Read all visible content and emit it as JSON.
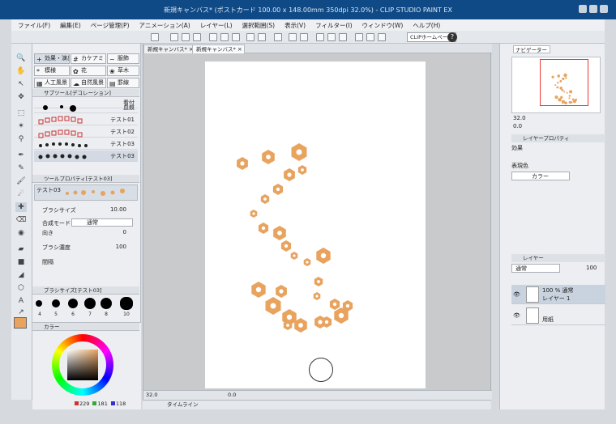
{
  "window": {
    "title": "新規キャンバス* (ポストカード 100.00 x 148.00mm 350dpi 32.0%) - CLIP STUDIO PAINT EX"
  },
  "menu": [
    "ファイル(F)",
    "編集(E)",
    "ページ管理(P)",
    "アニメーション(A)",
    "レイヤー(L)",
    "選択範囲(S)",
    "表示(V)",
    "フィルター(I)",
    "ウィンドウ(W)",
    "ヘルプ(H)"
  ],
  "command_bar": {
    "clip_home_label": "CLIPホームページ",
    "help_icon": "?"
  },
  "subtool_groups": [
    {
      "label": "効果・演出",
      "icon": "+"
    },
    {
      "label": "カケアミ・",
      "icon": "#"
    },
    {
      "label": "服飾",
      "icon": "~"
    },
    {
      "label": "模様",
      "icon": "*"
    },
    {
      "label": "花",
      "icon": "✿"
    },
    {
      "label": "草木",
      "icon": "❀"
    },
    {
      "label": "人工風景",
      "icon": "▦"
    },
    {
      "label": "自然風景",
      "icon": "☁"
    },
    {
      "label": "罫線",
      "icon": "▤"
    }
  ],
  "subtool_panel": {
    "title": "サブツール[デコレーション]"
  },
  "brushes": [
    {
      "label": "看付"
    },
    {
      "label": "血痕"
    },
    {
      "label": "テスト01"
    },
    {
      "label": "テスト02"
    },
    {
      "label": "テスト03"
    },
    {
      "label": "テスト03"
    }
  ],
  "tool_property": {
    "title": "ツールプロパティ[テスト03]",
    "brush_name": "テスト03",
    "brush_size_label": "ブラシサイズ",
    "brush_size_value": "10.00",
    "blend_mode_label": "合成モード",
    "blend_mode_value": "通常",
    "direction_label": "向き",
    "direction_value": "0",
    "density_label": "ブラシ濃度",
    "density_value": "100",
    "spacing_label": "間隔"
  },
  "brush_size_panel": {
    "title": "ブラシサイズ[テスト03]",
    "sizes": [
      "4",
      "5",
      "6",
      "7",
      "8",
      "10"
    ]
  },
  "color_panel": {
    "title": "カラー",
    "r": "229",
    "g": "181",
    "b": "118",
    "current_color": "#e8a35e"
  },
  "canvas": {
    "tabs": [
      "新規キャンバス*",
      "新規キャンバス*"
    ],
    "zoom": "32.0",
    "rotation": "0.0"
  },
  "timeline": {
    "label": "タイムライン"
  },
  "navigator": {
    "title": "ナビゲーター",
    "zoom": "32.0",
    "rotation": "0.0"
  },
  "layer_property": {
    "title": "レイヤープロパティ",
    "effect_label": "効果",
    "expression_label": "表現色",
    "expression_value": "カラー"
  },
  "layer_panel": {
    "title": "レイヤー",
    "blend_mode": "通常",
    "opacity": "100",
    "layers": [
      {
        "line1": "100 % 通常",
        "line2": "レイヤー 1",
        "selected": true
      },
      {
        "line1": "",
        "line2": "用紙",
        "selected": false
      }
    ]
  }
}
